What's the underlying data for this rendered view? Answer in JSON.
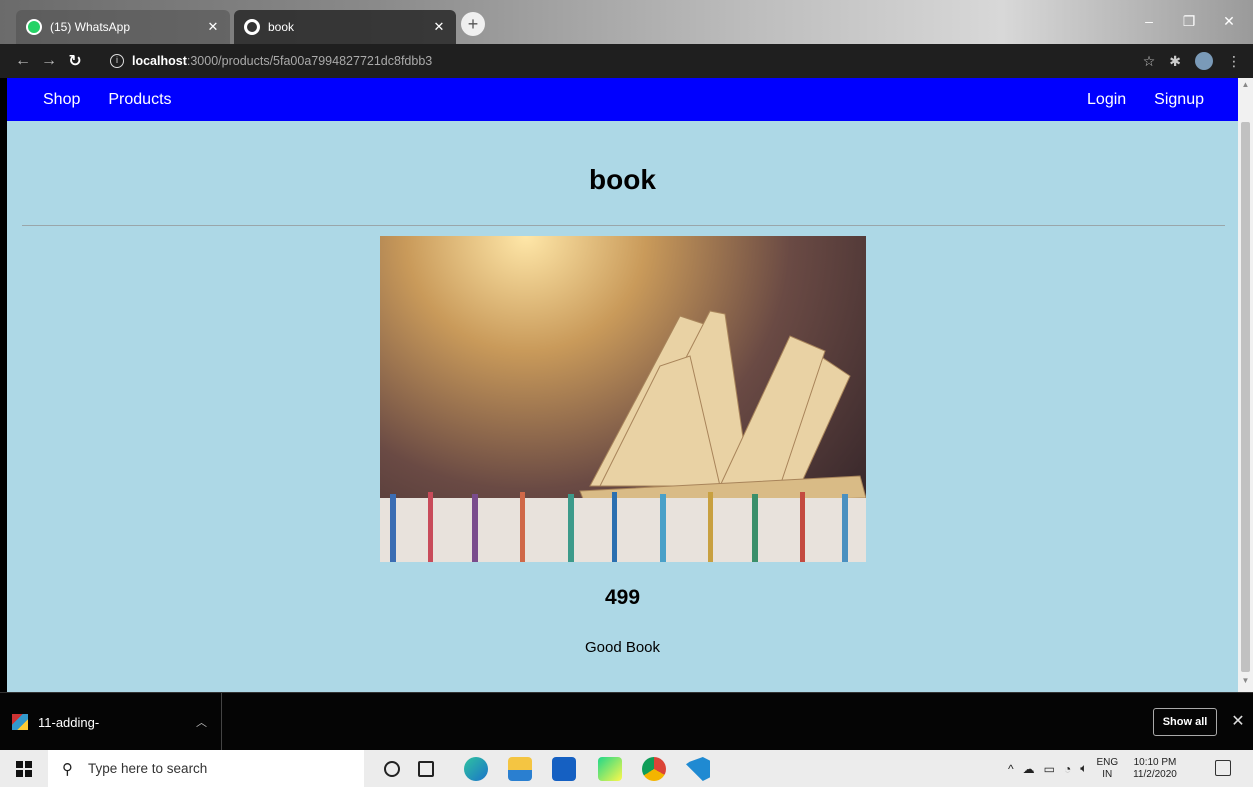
{
  "browser": {
    "tabs": [
      {
        "label": "(15) WhatsApp",
        "favicon": "whatsapp-icon",
        "active": false
      },
      {
        "label": "book",
        "favicon": "globe-icon",
        "active": true
      }
    ],
    "url_host": "localhost",
    "url_rest": ":3000/products/5fa00a7994827721dc8fdbb3"
  },
  "navbar": {
    "left_links": [
      "Shop",
      "Products"
    ],
    "right_links": [
      "Login",
      "Signup"
    ],
    "color": "#0000ff"
  },
  "product": {
    "title": "book",
    "price": "499",
    "description": "Good Book",
    "image_icon": "open-book-image"
  },
  "page": {
    "background": "#add8e6"
  },
  "download_bar": {
    "item_name": "11-adding-",
    "show_all_label": "Show all"
  },
  "taskbar": {
    "search_placeholder": "Type here to search",
    "lang_top": "ENG",
    "lang_bottom": "IN",
    "time": "10:10 PM",
    "date": "11/2/2020"
  }
}
